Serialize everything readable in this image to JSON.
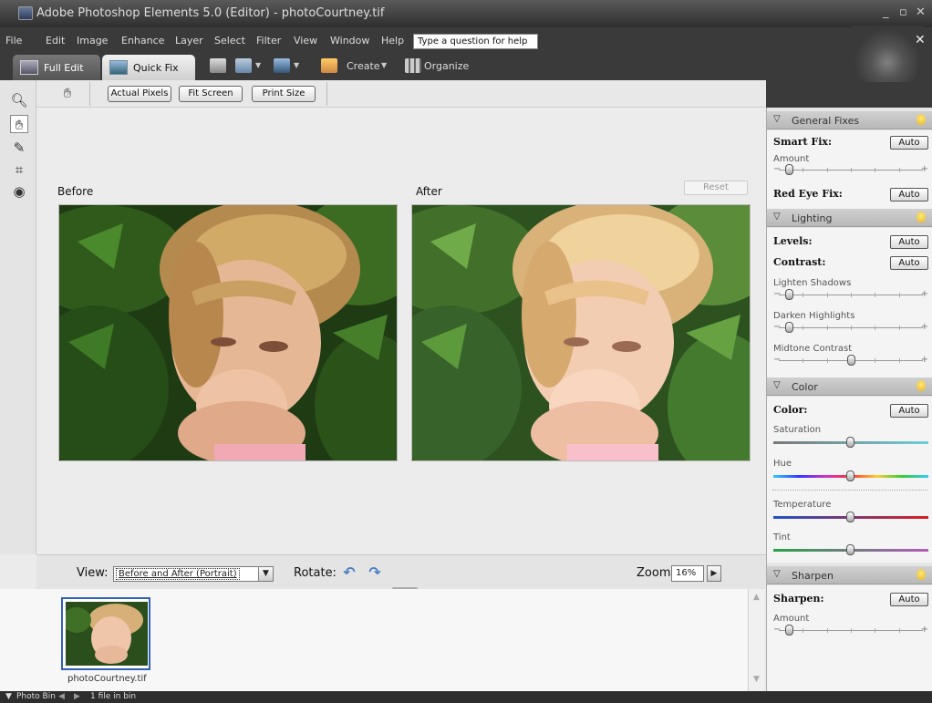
{
  "window": {
    "title": "Adobe Photoshop Elements 5.0 (Editor) - photoCourtney.tif",
    "minimize": "_",
    "restore": "▫",
    "close": "✕"
  },
  "menu": {
    "items": [
      "File",
      "Edit",
      "Image",
      "Enhance",
      "Layer",
      "Select",
      "Filter",
      "View",
      "Window",
      "Help"
    ],
    "help_placeholder": "Type a question for help",
    "doc_close": "✕"
  },
  "modes": {
    "full_edit": "Full Edit",
    "quick_fix": "Quick Fix",
    "create": "Create",
    "organize": "Organize"
  },
  "options": {
    "actual_pixels": "Actual Pixels",
    "fit_screen": "Fit Screen",
    "print_size": "Print Size"
  },
  "canvas": {
    "before_label": "Before",
    "after_label": "After",
    "reset": "Reset"
  },
  "viewbar": {
    "view_label": "View:",
    "view_value": "Before and After (Portrait)",
    "rotate_label": "Rotate:",
    "zoom_label": "Zoom:",
    "zoom_value": "16%"
  },
  "bin": {
    "thumb_name": "photoCourtney.tif"
  },
  "status": {
    "bin_label": "Photo Bin",
    "count": "1 file in bin"
  },
  "panel": {
    "general": {
      "title": "General Fixes",
      "smart_fix": "Smart Fix:",
      "amount": "Amount",
      "amount_value": 0.05,
      "red_eye": "Red Eye Fix:",
      "auto": "Auto"
    },
    "lighting": {
      "title": "Lighting",
      "levels": "Levels:",
      "contrast": "Contrast:",
      "lighten": "Lighten Shadows",
      "lighten_value": 0.05,
      "darken": "Darken Highlights",
      "darken_value": 0.05,
      "midtone": "Midtone Contrast",
      "midtone_value": 0.5,
      "auto": "Auto"
    },
    "color": {
      "title": "Color",
      "color": "Color:",
      "saturation": "Saturation",
      "saturation_value": 0.5,
      "hue": "Hue",
      "hue_value": 0.5,
      "temperature": "Temperature",
      "temperature_value": 0.5,
      "tint": "Tint",
      "tint_value": 0.5,
      "auto": "Auto"
    },
    "sharpen": {
      "title": "Sharpen",
      "sharpen": "Sharpen:",
      "amount": "Amount",
      "amount_value": 0.05,
      "auto": "Auto"
    }
  },
  "colors": {
    "accent": "#2f61b9",
    "rotate_arrows": "#4a7ec4"
  }
}
